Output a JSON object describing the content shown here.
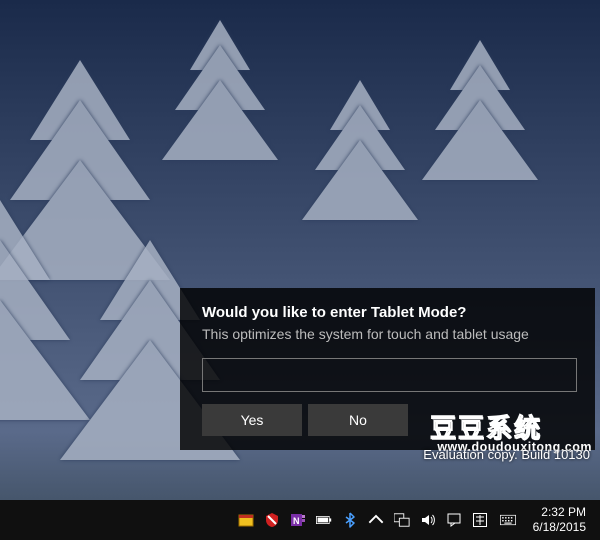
{
  "toast": {
    "title": "Would you like to enter Tablet Mode?",
    "body": "This optimizes the system for touch and tablet usage",
    "yes_label": "Yes",
    "no_label": "No"
  },
  "watermark": {
    "cn_text": "豆豆系统",
    "url_text": "www.doudouxitong.com"
  },
  "desktop": {
    "evaluation_text": "Evaluation copy. Build 10130"
  },
  "taskbar": {
    "clock": {
      "time": "2:32 PM",
      "date": "6/18/2015"
    },
    "tray_icons": {
      "security": "security-icon",
      "shield": "shield-icon",
      "onenote": "onenote-icon",
      "battery": "battery-icon",
      "bluetooth": "bluetooth-icon",
      "chevron": "tray-overflow-icon",
      "network": "network-icon",
      "volume": "volume-icon",
      "action_center": "action-center-icon",
      "ime": "ime-icon",
      "keyboard": "touch-keyboard-icon"
    }
  }
}
